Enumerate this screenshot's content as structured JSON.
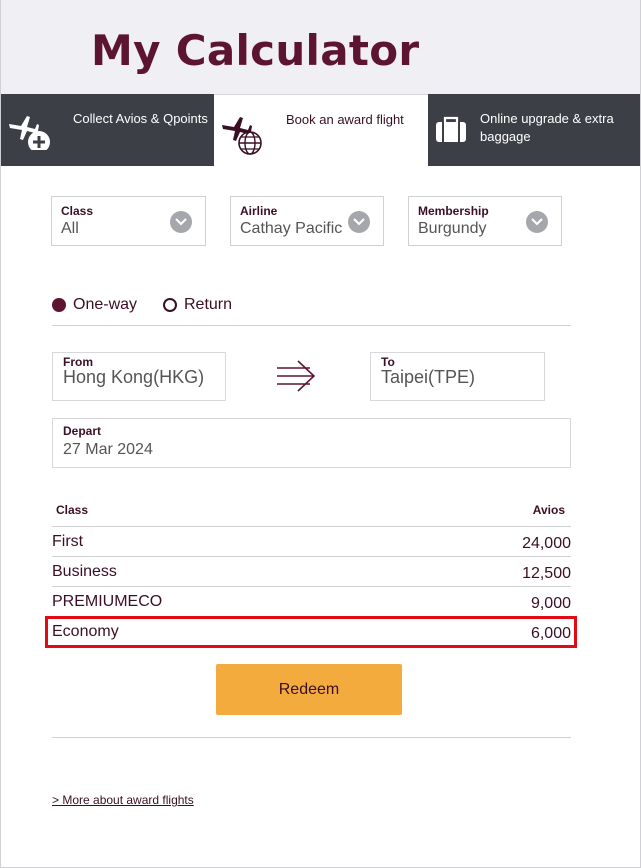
{
  "header": {
    "title": "My Calculator"
  },
  "tabs": [
    {
      "label": "Collect Avios & Qpoints",
      "icon": "plane-plus-icon"
    },
    {
      "label": "Book an award flight",
      "icon": "plane-globe-icon"
    },
    {
      "label": "Online upgrade & extra baggage",
      "icon": "baggage-icon"
    }
  ],
  "filters": {
    "class": {
      "label": "Class",
      "value": "All"
    },
    "airline": {
      "label": "Airline",
      "value": "Cathay Pacific"
    },
    "membership": {
      "label": "Membership",
      "value": "Burgundy"
    }
  },
  "trip_type": {
    "oneway": "One-way",
    "return": "Return",
    "selected": "One-way"
  },
  "route": {
    "from_label": "From",
    "from_value": "Hong Kong(HKG)",
    "to_label": "To",
    "to_value": "Taipei(TPE)",
    "depart_label": "Depart",
    "depart_value": "27 Mar 2024"
  },
  "results": {
    "col_class": "Class",
    "col_avios": "Avios",
    "rows": [
      {
        "class": "First",
        "avios": "24,000"
      },
      {
        "class": "Business",
        "avios": "12,500"
      },
      {
        "class": "PREMIUMECO",
        "avios": "9,000"
      },
      {
        "class": "Economy",
        "avios": "6,000"
      }
    ]
  },
  "redeem_label": "Redeem",
  "more_link": "> More about award flights",
  "colors": {
    "brand": "#5c1430",
    "accent": "#f3ab3e",
    "tab_dark": "#3d3f46",
    "highlight": "#e20b14"
  }
}
